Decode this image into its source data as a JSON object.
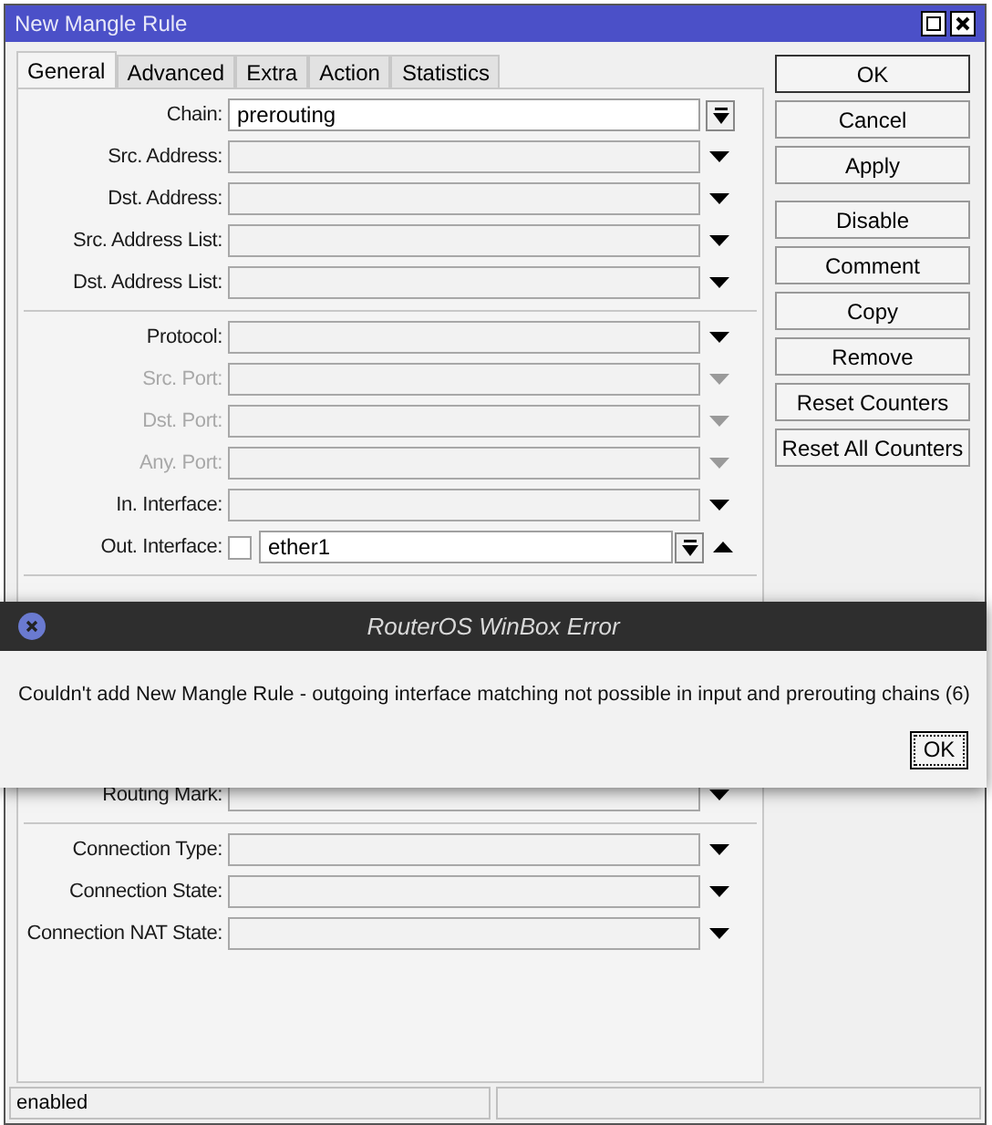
{
  "window": {
    "title": "New Mangle Rule"
  },
  "tabs": [
    {
      "label": "General",
      "selected": true
    },
    {
      "label": "Advanced",
      "selected": false
    },
    {
      "label": "Extra",
      "selected": false
    },
    {
      "label": "Action",
      "selected": false
    },
    {
      "label": "Statistics",
      "selected": false
    }
  ],
  "field_groups": [
    [
      {
        "label": "Chain:",
        "value": "prerouting",
        "kind": "combo",
        "disabled": false
      },
      {
        "label": "Src. Address:",
        "kind": "dropdown",
        "disabled": false
      },
      {
        "label": "Dst. Address:",
        "kind": "dropdown",
        "disabled": false
      },
      {
        "label": "Src. Address List:",
        "kind": "dropdown",
        "disabled": false
      },
      {
        "label": "Dst. Address List:",
        "kind": "dropdown",
        "disabled": false
      }
    ],
    [
      {
        "label": "Protocol:",
        "kind": "dropdown",
        "disabled": false
      },
      {
        "label": "Src. Port:",
        "kind": "dropdown",
        "disabled": true
      },
      {
        "label": "Dst. Port:",
        "kind": "dropdown",
        "disabled": true
      },
      {
        "label": "Any. Port:",
        "kind": "dropdown",
        "disabled": true
      },
      {
        "label": "In. Interface:",
        "kind": "dropdown",
        "disabled": false
      },
      {
        "label": "Out. Interface:",
        "value": "ether1",
        "kind": "negatable",
        "negated": false,
        "disabled": false
      }
    ],
    [
      {
        "label": "Routing Mark:",
        "kind": "dropdown"
      }
    ],
    [
      {
        "label": "Connection Type:",
        "kind": "dropdown",
        "disabled": false
      },
      {
        "label": "Connection State:",
        "kind": "dropdown",
        "disabled": false
      },
      {
        "label": "Connection NAT State:",
        "kind": "dropdown",
        "disabled": false
      }
    ]
  ],
  "button_groups": [
    [
      {
        "label": "OK",
        "default": true
      },
      {
        "label": "Cancel",
        "default": false
      },
      {
        "label": "Apply",
        "default": false
      }
    ],
    [
      {
        "label": "Disable",
        "default": false
      },
      {
        "label": "Comment",
        "default": false
      },
      {
        "label": "Copy",
        "default": false
      },
      {
        "label": "Remove",
        "default": false
      },
      {
        "label": "Reset Counters",
        "default": false
      },
      {
        "label": "Reset All Counters",
        "default": false
      }
    ]
  ],
  "status_bar": {
    "text": "enabled"
  },
  "error_dialog": {
    "title": "RouterOS WinBox Error",
    "message": "Couldn't add New Mangle Rule - outgoing interface matching not possible in input and prerouting chains (6)",
    "button": "OK"
  }
}
